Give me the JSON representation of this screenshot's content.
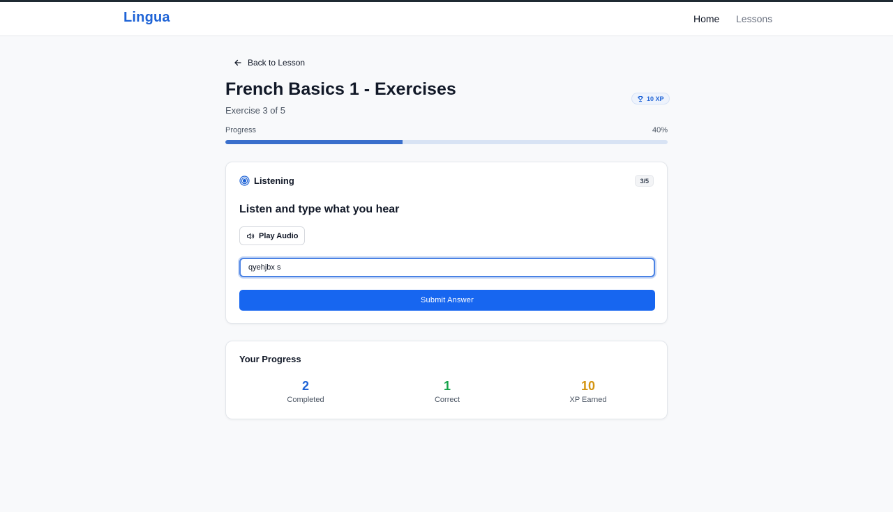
{
  "app": {
    "logo": "Lingua"
  },
  "nav": {
    "home": "Home",
    "lessons": "Lessons"
  },
  "back": {
    "label": "Back to Lesson"
  },
  "lesson": {
    "title": "French Basics 1 - Exercises",
    "subtitle": "Exercise 3 of 5",
    "xp_badge": "10 XP"
  },
  "progress": {
    "label": "Progress",
    "percent_text": "40%",
    "value": 0.4
  },
  "exercise": {
    "type": "Listening",
    "counter": "3/5",
    "question": "Listen and type what you hear",
    "play_label": "Play Audio",
    "answer_value": "qyehjbx s",
    "submit_label": "Submit Answer"
  },
  "stats": {
    "title": "Your Progress",
    "items": [
      {
        "value": "2",
        "label": "Completed",
        "color": "#1e63d6"
      },
      {
        "value": "1",
        "label": "Correct",
        "color": "#15a34a"
      },
      {
        "value": "10",
        "label": "XP Earned",
        "color": "#d49410"
      }
    ]
  },
  "colors": {
    "accent": "#1766f0",
    "brand": "#1e63d6",
    "progress_fill": "#3a6fcc",
    "progress_track": "#d8e3f4"
  },
  "icons": {
    "back": "arrow-left-icon",
    "xp": "trophy-icon",
    "exercise_type": "target-icon",
    "play": "speaker-icon"
  }
}
